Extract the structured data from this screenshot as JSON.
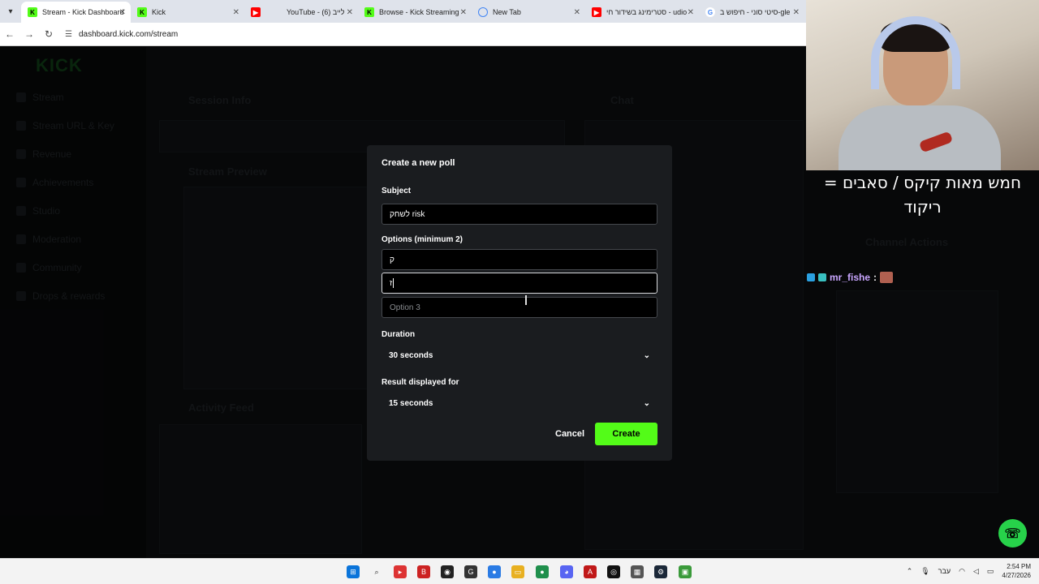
{
  "browser": {
    "tabs": [
      {
        "title": "Stream - Kick Dashboard",
        "favicon": "kick-icon",
        "color": "#53fc18",
        "active": true
      },
      {
        "title": "Kick",
        "favicon": "kick-icon",
        "color": "#53fc18",
        "active": false
      },
      {
        "title": "YouTube - לייב (6)",
        "favicon": "youtube-icon",
        "color": "#ff0000",
        "active": false
      },
      {
        "title": "Browse - Kick Streaming",
        "favicon": "kick-icon",
        "color": "#53fc18",
        "active": false
      },
      {
        "title": "New Tab",
        "favicon": "chrome-icon",
        "color": "#4285f4",
        "active": false
      },
      {
        "title": "סטרימינג בשידור חי - udio",
        "favicon": "youtube-icon",
        "color": "#ff0000",
        "active": false
      },
      {
        "title": "סיטי סוני - חיפוש ב-gle",
        "favicon": "google-icon",
        "color": "#ffffff",
        "active": false
      }
    ],
    "url": "dashboard.kick.com/stream"
  },
  "background": {
    "logo": "KICK",
    "sidebar_items": [
      "Stream",
      "Stream URL & Key",
      "Revenue",
      "Achievements",
      "Studio",
      "Moderation",
      "Community",
      "Drops & rewards"
    ],
    "panels": {
      "session_info": "Session Info",
      "stream_preview": "Stream Preview",
      "activity_feed": "Activity Feed",
      "chat": "Chat",
      "channel_actions": "Channel Actions"
    }
  },
  "webcam_caption": "חמש מאות קיקס / סאבים = ריקוד",
  "chat_message": {
    "username": "mr_fishe",
    "separator": ":"
  },
  "modal": {
    "title": "Create a new poll",
    "subject_label": "Subject",
    "subject_value": "לשחק risk",
    "options_label": "Options (minimum 2)",
    "options": [
      {
        "value": "ק",
        "placeholder": ""
      },
      {
        "value": "ז",
        "placeholder": ""
      },
      {
        "value": "",
        "placeholder": "Option 3"
      }
    ],
    "duration_label": "Duration",
    "duration_value": "30 seconds",
    "result_label": "Result displayed for",
    "result_value": "15 seconds",
    "cancel_label": "Cancel",
    "create_label": "Create",
    "accent_color": "#53fc18"
  },
  "taskbar": {
    "language": "עבר",
    "time": "2:54 PM",
    "date": "4/27/2026"
  }
}
